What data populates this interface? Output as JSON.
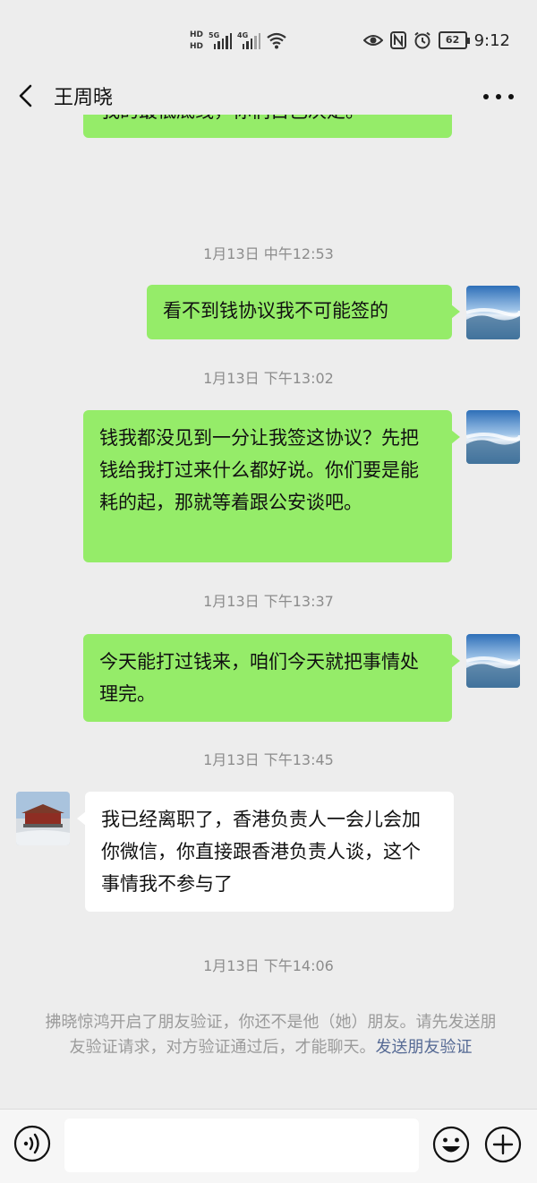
{
  "status_bar": {
    "hd1": "HD",
    "hd2": "HD",
    "sim1_label": "5G",
    "sim2_label": "4G",
    "battery": "62",
    "time": "9:12"
  },
  "header": {
    "title": "王周晓",
    "back_icon": "chevron-left-icon",
    "more_icon": "more-dots-icon"
  },
  "messages": [
    {
      "type": "sent",
      "text": "我来电话，该签的我也跟你们签，这是我的最低底线，你们自己决定。"
    },
    {
      "type": "time",
      "text": "1月13日 中午12:53"
    },
    {
      "type": "sent",
      "text": "看不到钱协议我不可能签的"
    },
    {
      "type": "time",
      "text": "1月13日 下午13:02"
    },
    {
      "type": "sent",
      "text": "钱我都没见到一分让我签这协议？先把钱给我打过来什么都好说。你们要是能耗的起，那就等着跟公安谈吧。"
    },
    {
      "type": "time",
      "text": "1月13日 下午13:37"
    },
    {
      "type": "sent",
      "text": "今天能打过钱来，咱们今天就把事情处理完。"
    },
    {
      "type": "time",
      "text": "1月13日 下午13:45"
    },
    {
      "type": "received",
      "text": "我已经离职了，香港负责人一会儿会加你微信，你直接跟香港负责人谈，这个事情我不参与了"
    },
    {
      "type": "time",
      "text": "1月13日 下午14:06"
    }
  ],
  "system_notice": {
    "text": "拂晓惊鸿开启了朋友验证，你还不是他（她）朋友。请先发送朋友验证请求，对方验证通过后，才能聊天。",
    "link": "发送朋友验证"
  },
  "input_bar": {
    "placeholder": "",
    "voice_icon": "voice-icon",
    "emoji_icon": "emoji-icon",
    "plus_icon": "plus-icon"
  },
  "colors": {
    "sent_bubble": "#95ec69",
    "received_bubble": "#ffffff",
    "background": "#ededed",
    "link": "#576b95"
  }
}
